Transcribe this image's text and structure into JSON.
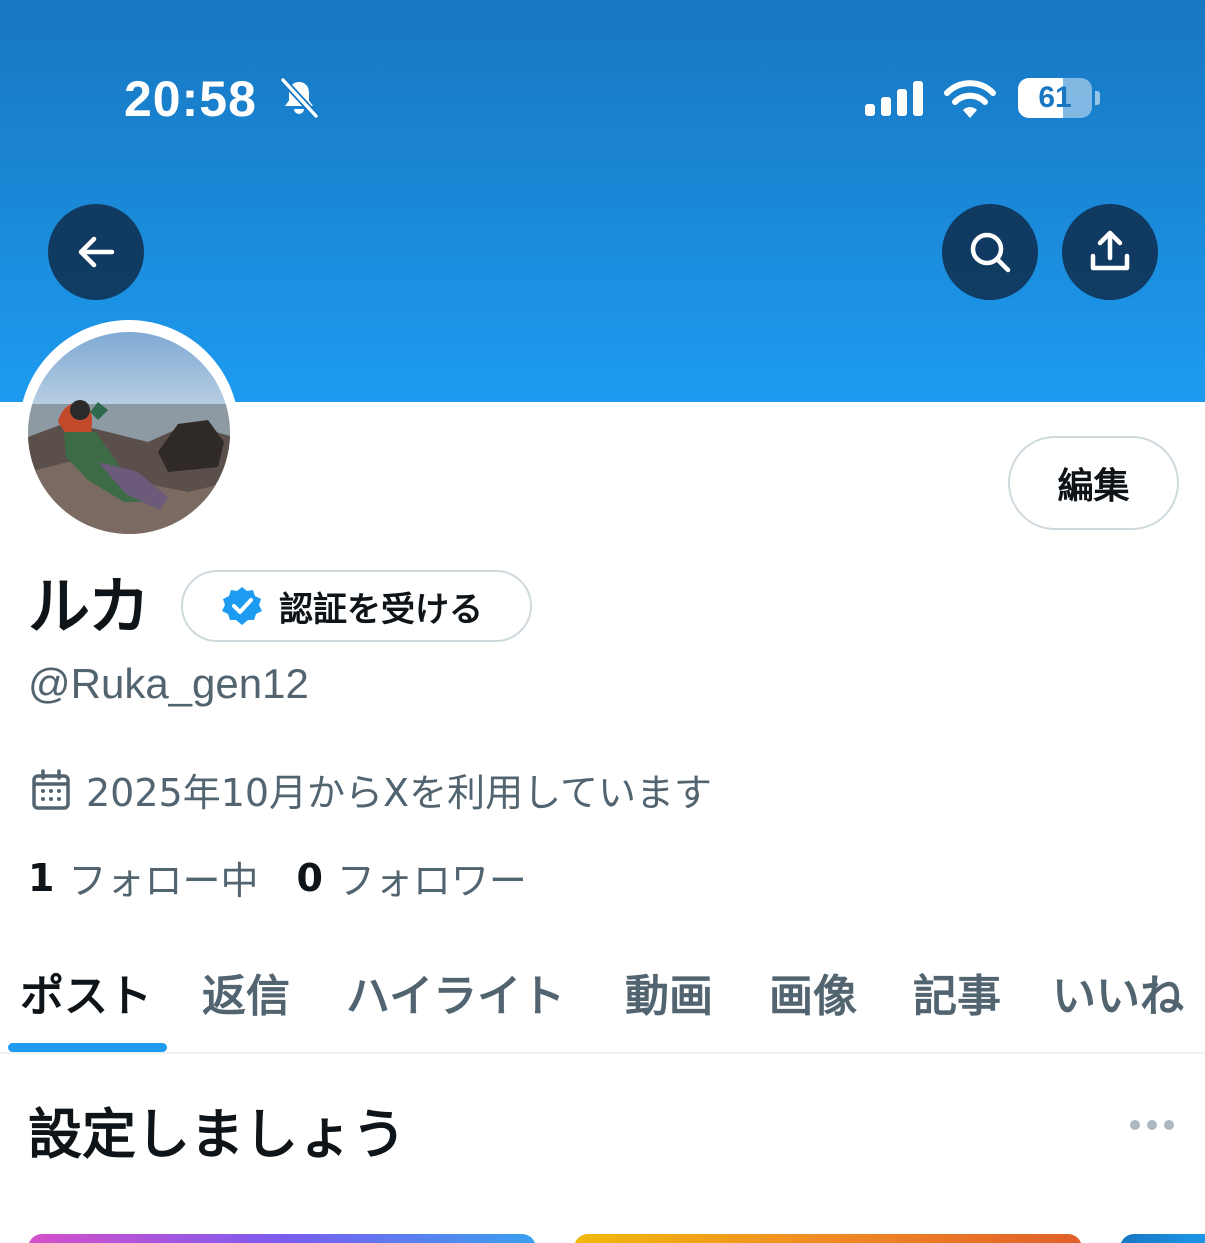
{
  "status_bar": {
    "time": "20:58",
    "battery_level": "61",
    "icons": [
      "bell-slash-icon",
      "signal-bars-icon",
      "wifi-icon",
      "battery-icon"
    ]
  },
  "header": {
    "back_icon": "arrow-left-icon",
    "search_icon": "search-icon",
    "share_icon": "share-upload-icon",
    "banner_color": "#1d9bf0"
  },
  "profile": {
    "display_name": "ルカ",
    "verify_label": "認証を受ける",
    "handle": "@Ruka_gen12",
    "edit_label": "編集",
    "joined": "2025年10月からXを利用しています",
    "following_count": "1",
    "following_label": "フォロー中",
    "followers_count": "0",
    "followers_label": "フォロワー"
  },
  "tabs": [
    {
      "label": "ポスト",
      "active": true
    },
    {
      "label": "返信",
      "active": false
    },
    {
      "label": "ハイライト",
      "active": false
    },
    {
      "label": "動画",
      "active": false
    },
    {
      "label": "画像",
      "active": false
    },
    {
      "label": "記事",
      "active": false
    },
    {
      "label": "いいね",
      "active": false
    }
  ],
  "setup": {
    "title": "設定しましょう",
    "more_icon": "more-horizontal-icon"
  },
  "colors": {
    "accent": "#1d9bf0",
    "text_primary": "#0f1419",
    "text_secondary": "#536471",
    "border": "#cfd9de"
  }
}
